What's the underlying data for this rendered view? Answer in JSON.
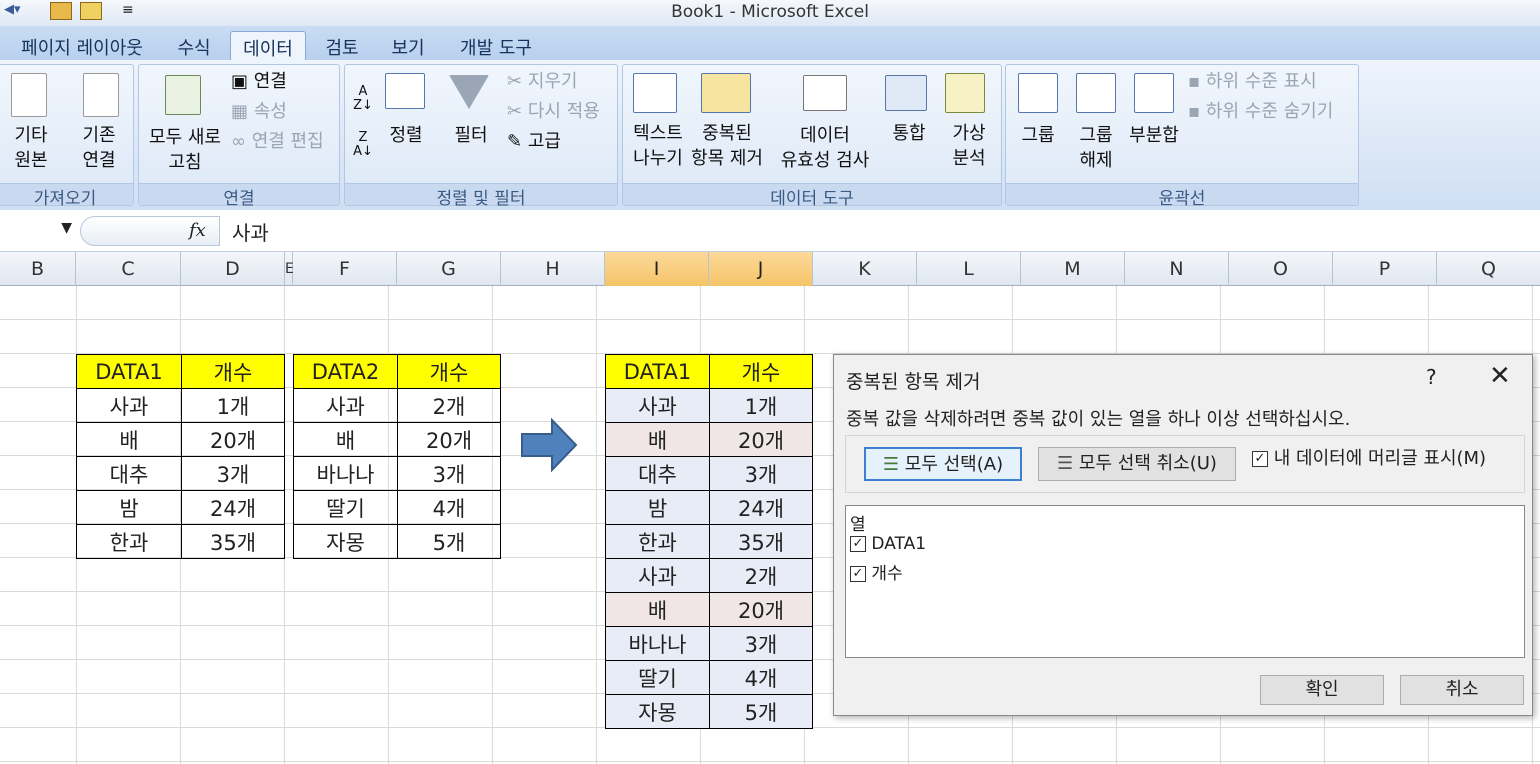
{
  "window": {
    "title": "Book1 - Microsoft Excel"
  },
  "tabs": [
    {
      "label": "페이지 레이아웃"
    },
    {
      "label": "수식"
    },
    {
      "label": "데이터"
    },
    {
      "label": "검토"
    },
    {
      "label": "보기"
    },
    {
      "label": "개발 도구"
    }
  ],
  "ribbon": {
    "external": {
      "group": "가져오기",
      "other_sources": "기타",
      "other_sources2": "원본",
      "existing_conn": "기존",
      "existing_conn2": "연결"
    },
    "connections": {
      "group": "연결",
      "refresh_all": "모두 새로",
      "refresh_all2": "고침",
      "connections": "연결",
      "properties": "속성",
      "edit_links": "연결 편집"
    },
    "sort_filter": {
      "group": "정렬 및 필터",
      "sort": "정렬",
      "filter": "필터",
      "clear": "지우기",
      "reapply": "다시 적용",
      "advanced": "고급"
    },
    "data_tools": {
      "group": "데이터 도구",
      "text_to_columns": "텍스트",
      "text_to_columns2": "나누기",
      "remove_dup": "중복된",
      "remove_dup2": "항목 제거",
      "validation": "데이터",
      "validation2": "유효성 검사",
      "consolidate": "통합",
      "whatif": "가상",
      "whatif2": "분석"
    },
    "outline": {
      "group": "윤곽선",
      "group_btn": "그룹",
      "ungroup": "그룹",
      "ungroup2": "해제",
      "subtotal": "부분합",
      "show_detail": "하위 수준 표시",
      "hide_detail": "하위 수준 숨기기"
    }
  },
  "formula_bar": {
    "fx": "fx",
    "value": "사과"
  },
  "columns": [
    "B",
    "C",
    "D",
    "E",
    "F",
    "G",
    "H",
    "I",
    "J",
    "K",
    "L",
    "M",
    "N",
    "O",
    "P",
    "Q"
  ],
  "table1": {
    "headers": [
      "DATA1",
      "개수"
    ],
    "rows": [
      [
        "사과",
        "1개"
      ],
      [
        "배",
        "20개"
      ],
      [
        "대추",
        "3개"
      ],
      [
        "밤",
        "24개"
      ],
      [
        "한과",
        "35개"
      ]
    ]
  },
  "table2": {
    "headers": [
      "DATA2",
      "개수"
    ],
    "rows": [
      [
        "사과",
        "2개"
      ],
      [
        "배",
        "20개"
      ],
      [
        "바나나",
        "3개"
      ],
      [
        "딸기",
        "4개"
      ],
      [
        "자몽",
        "5개"
      ]
    ]
  },
  "table3": {
    "headers": [
      "DATA1",
      "개수"
    ],
    "rows": [
      [
        "사과",
        "1개"
      ],
      [
        "배",
        "20개"
      ],
      [
        "대추",
        "3개"
      ],
      [
        "밤",
        "24개"
      ],
      [
        "한과",
        "35개"
      ],
      [
        "사과",
        "2개"
      ],
      [
        "배",
        "20개"
      ],
      [
        "바나나",
        "3개"
      ],
      [
        "딸기",
        "4개"
      ],
      [
        "자몽",
        "5개"
      ]
    ]
  },
  "dialog": {
    "title": "중복된 항목 제거",
    "help": "?",
    "close": "✕",
    "instruction": "중복 값을 삭제하려면 중복 값이 있는 열을 하나 이상 선택하십시오.",
    "select_all": "모두 선택(A)",
    "unselect_all": "모두 선택 취소(U)",
    "header_checkbox": "내 데이터에 머리글 표시(M)",
    "list_header": "열",
    "items": [
      "DATA1",
      "개수"
    ],
    "ok": "확인",
    "cancel": "취소"
  }
}
